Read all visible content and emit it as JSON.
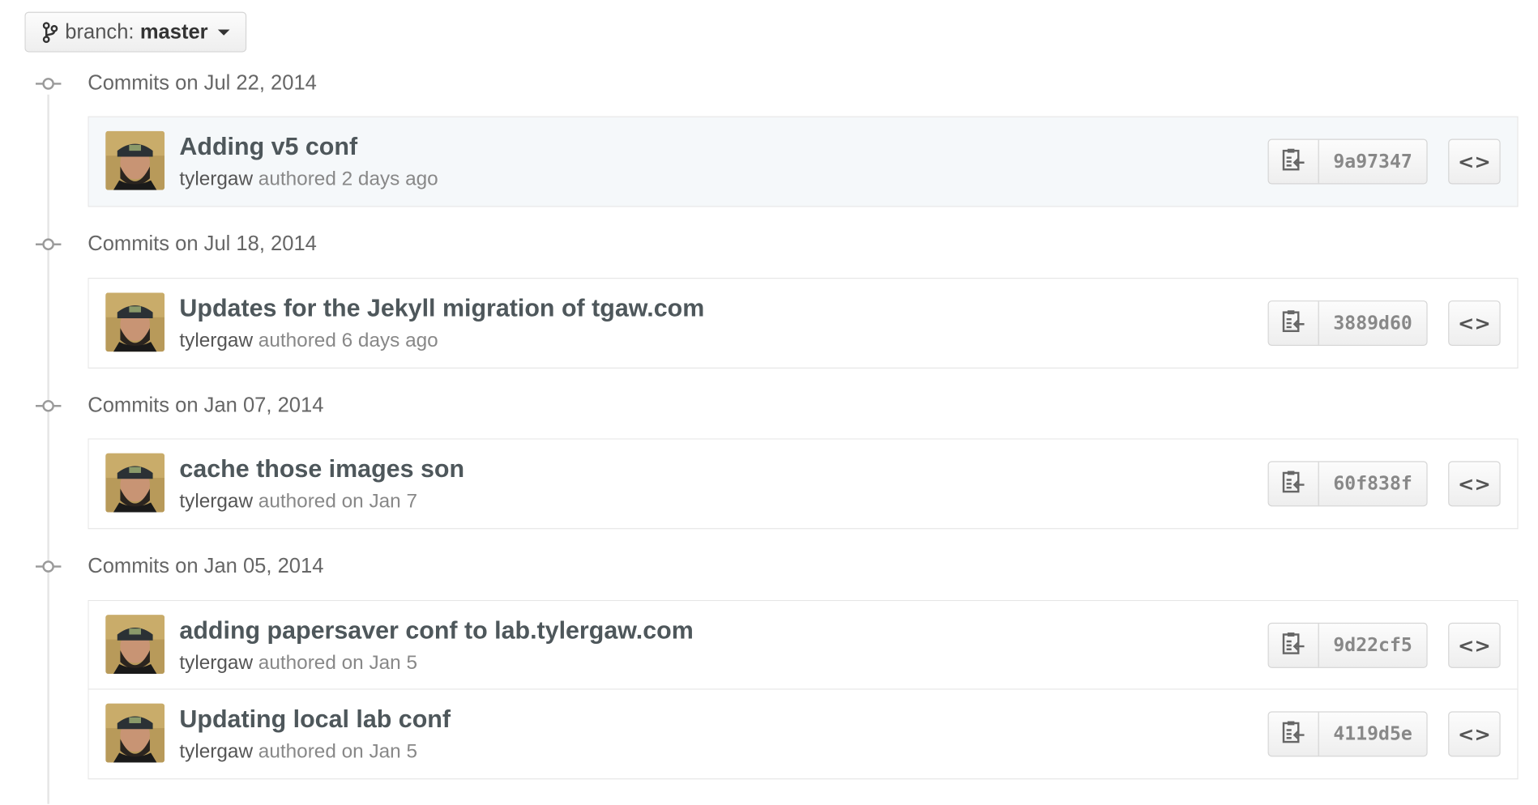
{
  "branch": {
    "label": "branch:",
    "name": "master"
  },
  "groups": [
    {
      "date": "Commits on Jul 22, 2014",
      "commits": [
        {
          "title": "Adding v5 conf",
          "author": "tylergaw",
          "meta": "authored 2 days ago",
          "sha": "9a97347",
          "browse": "<>"
        }
      ]
    },
    {
      "date": "Commits on Jul 18, 2014",
      "commits": [
        {
          "title": "Updates for the Jekyll migration of tgaw.com",
          "author": "tylergaw",
          "meta": "authored 6 days ago",
          "sha": "3889d60",
          "browse": "<>"
        }
      ]
    },
    {
      "date": "Commits on Jan 07, 2014",
      "commits": [
        {
          "title": "cache those images son",
          "author": "tylergaw",
          "meta": "authored on Jan 7",
          "sha": "60f838f",
          "browse": "<>"
        }
      ]
    },
    {
      "date": "Commits on Jan 05, 2014",
      "commits": [
        {
          "title": "adding papersaver conf to lab.tylergaw.com",
          "author": "tylergaw",
          "meta": "authored on Jan 5",
          "sha": "9d22cf5",
          "browse": "<>"
        },
        {
          "title": "Updating local lab conf",
          "author": "tylergaw",
          "meta": "authored on Jan 5",
          "sha": "4119d5e",
          "browse": "<>"
        }
      ]
    }
  ]
}
